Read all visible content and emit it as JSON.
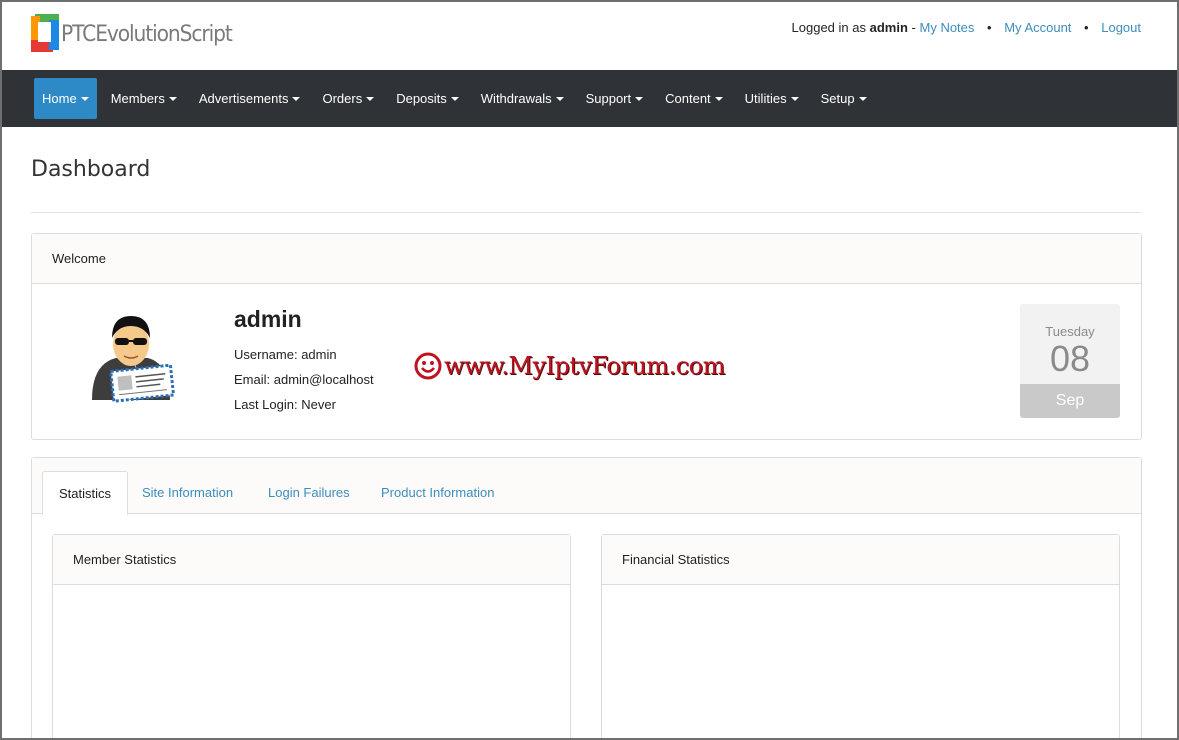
{
  "header": {
    "logo_text": "PTCEvolutionScript",
    "logged_in_prefix": "Logged in as",
    "username": "admin",
    "separator": "-",
    "links": [
      "My Notes",
      "My Account",
      "Logout"
    ],
    "bullet": "•"
  },
  "nav": {
    "items": [
      "Home",
      "Members",
      "Advertisements",
      "Orders",
      "Deposits",
      "Withdrawals",
      "Support",
      "Content",
      "Utilities",
      "Setup"
    ],
    "active": "Home",
    "active_color": "#2d8ac7",
    "bar_color": "#2f3237"
  },
  "page": {
    "title": "Dashboard"
  },
  "welcome": {
    "header": "Welcome",
    "name": "admin",
    "username_line": "Username: admin",
    "email_line": "Email: admin@localhost",
    "last_login_line": "Last Login: Never",
    "watermark": "www.MyIptvForum.com",
    "avatar_icon": "admin-avatar-icon",
    "date": {
      "weekday": "Tuesday",
      "day": "08",
      "month": "Sep"
    }
  },
  "tabs": {
    "items": [
      "Statistics",
      "Site Information",
      "Login Failures",
      "Product Information"
    ],
    "active": "Statistics"
  },
  "panels": {
    "member_title": "Member Statistics",
    "financial_title": "Financial Statistics"
  },
  "colors": {
    "link": "#3c8dbc",
    "watermark": "#c1121f"
  }
}
